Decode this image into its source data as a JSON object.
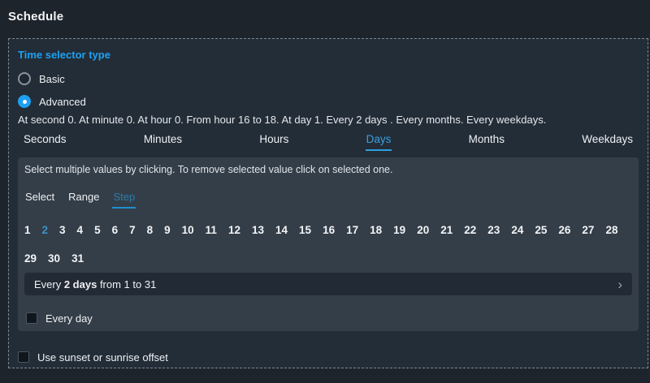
{
  "title": "Schedule",
  "accent": "#1da1f0",
  "time_selector": {
    "label": "Time selector type",
    "options": [
      {
        "label": "Basic",
        "selected": false
      },
      {
        "label": "Advanced",
        "selected": true
      }
    ]
  },
  "summary": "At second 0. At minute 0. At hour 0. From hour 16 to 18. At day 1. Every 2 days . Every months. Every weekdays.",
  "period_tabs": {
    "items": [
      "Seconds",
      "Minutes",
      "Hours",
      "Days",
      "Months",
      "Weekdays"
    ],
    "selected": "Days"
  },
  "panel": {
    "hint": "Select multiple values by clicking. To remove selected value click on selected one.",
    "mode_tabs": {
      "items": [
        "Select",
        "Range",
        "Step"
      ],
      "selected": "Step"
    },
    "days": [
      "1",
      "2",
      "3",
      "4",
      "5",
      "6",
      "7",
      "8",
      "9",
      "10",
      "11",
      "12",
      "13",
      "14",
      "15",
      "16",
      "17",
      "18",
      "19",
      "20",
      "21",
      "22",
      "23",
      "24",
      "25",
      "26",
      "27",
      "28",
      "29",
      "30",
      "31"
    ],
    "selected_day": "2",
    "step_bar": {
      "prefix": "Every ",
      "value": "2 days",
      "suffix": " from 1 to 31",
      "chevron": "›"
    },
    "every_day": {
      "label": "Every day",
      "checked": false
    }
  },
  "sunset": {
    "label": "Use sunset or sunrise offset",
    "checked": false
  }
}
